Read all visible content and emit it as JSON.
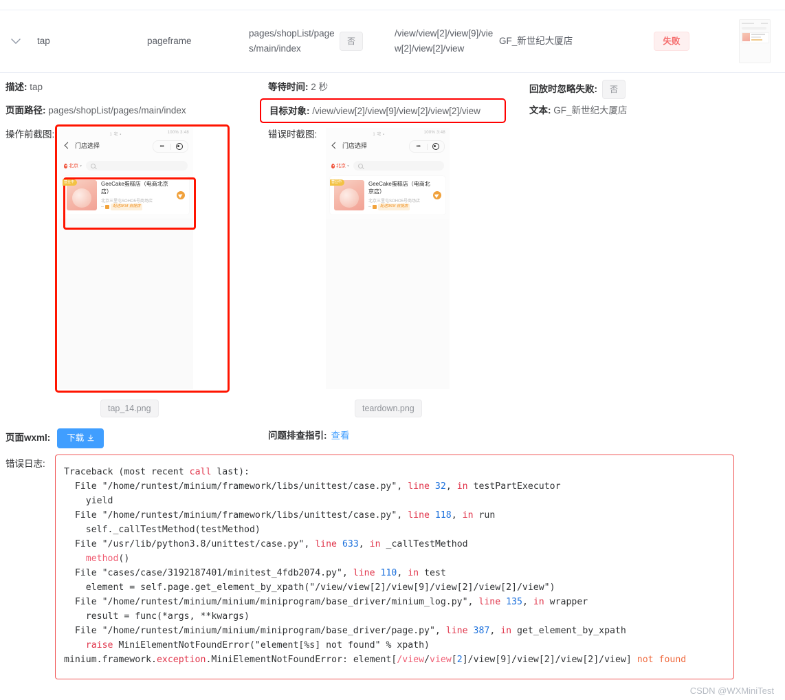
{
  "summary_row": {
    "expand_icon": "chevron-down-icon",
    "action": "tap",
    "frame": "pageframe",
    "page_path": "pages/shopList/pages/main/index",
    "ignore_failure": "否",
    "target_object": "/view/view[2]/view[9]/view[2]/view[2]/view",
    "text": "GF_新世纪大厦店",
    "status": "失败",
    "status_color": "#f56c6c"
  },
  "details": {
    "desc_label": "描述:",
    "desc_value": "tap",
    "wait_label": "等待时间:",
    "wait_value": "2 秒",
    "ignore_label": "回放时忽略失败:",
    "ignore_value": "否",
    "pagepath_label": "页面路径:",
    "pagepath_value": "pages/shopList/pages/main/index",
    "target_label": "目标对象:",
    "target_value": "/view/view[2]/view[9]/view[2]/view[2]/view",
    "text_label": "文本:",
    "text_value": "GF_新世纪大厦店"
  },
  "screenshots": {
    "before_label": "操作前截图:",
    "error_label": "错误时截图:",
    "before_caption": "tap_14.png",
    "error_caption": "teardown.png",
    "phone": {
      "status_left": "1 宅 ▪",
      "status_right": "100%  3:48",
      "nav_title": "门店选择",
      "dots": "•••",
      "city": "北京",
      "caret": "▾",
      "badge": "营业中",
      "card_title": "GeeCake蛋糕店（电商北京店）",
      "card_address": "北京三里屯SOHO5号商场店",
      "card_tag": "配送3KM 自提店"
    }
  },
  "wxml": {
    "label": "页面wxml:",
    "download_button": "下载",
    "download_icon": "download-icon"
  },
  "guide": {
    "label": "问题排查指引:",
    "link": "查看"
  },
  "error_log": {
    "label": "错误日志:",
    "lines": [
      "Traceback (most recent call last):",
      "  File \"/home/runtest/minium/framework/libs/unittest/case.py\", line 32, in testPartExecutor",
      "    yield",
      "  File \"/home/runtest/minium/framework/libs/unittest/case.py\", line 118, in run",
      "    self._callTestMethod(testMethod)",
      "  File \"/usr/lib/python3.8/unittest/case.py\", line 633, in _callTestMethod",
      "    method()",
      "  File \"cases/case/3192187401/minitest_4fdb2074.py\", line 110, in test",
      "    element = self.page.get_element_by_xpath(\"/view/view[2]/view[9]/view[2]/view[2]/view\")",
      "  File \"/home/runtest/minium/minium/miniprogram/base_driver/minium_log.py\", line 135, in wrapper",
      "    result = func(*args, **kwargs)",
      "  File \"/home/runtest/minium/minium/miniprogram/base_driver/page.py\", line 387, in get_element_by_xpath",
      "    raise MiniElementNotFoundError(\"element[%s] not found\" % xpath)",
      "minium.framework.exception.MiniElementNotFoundError: element[/view/view[2]/view[9]/view[2]/view[2]/view] not found"
    ]
  },
  "watermark": "CSDN @WXMiniTest"
}
